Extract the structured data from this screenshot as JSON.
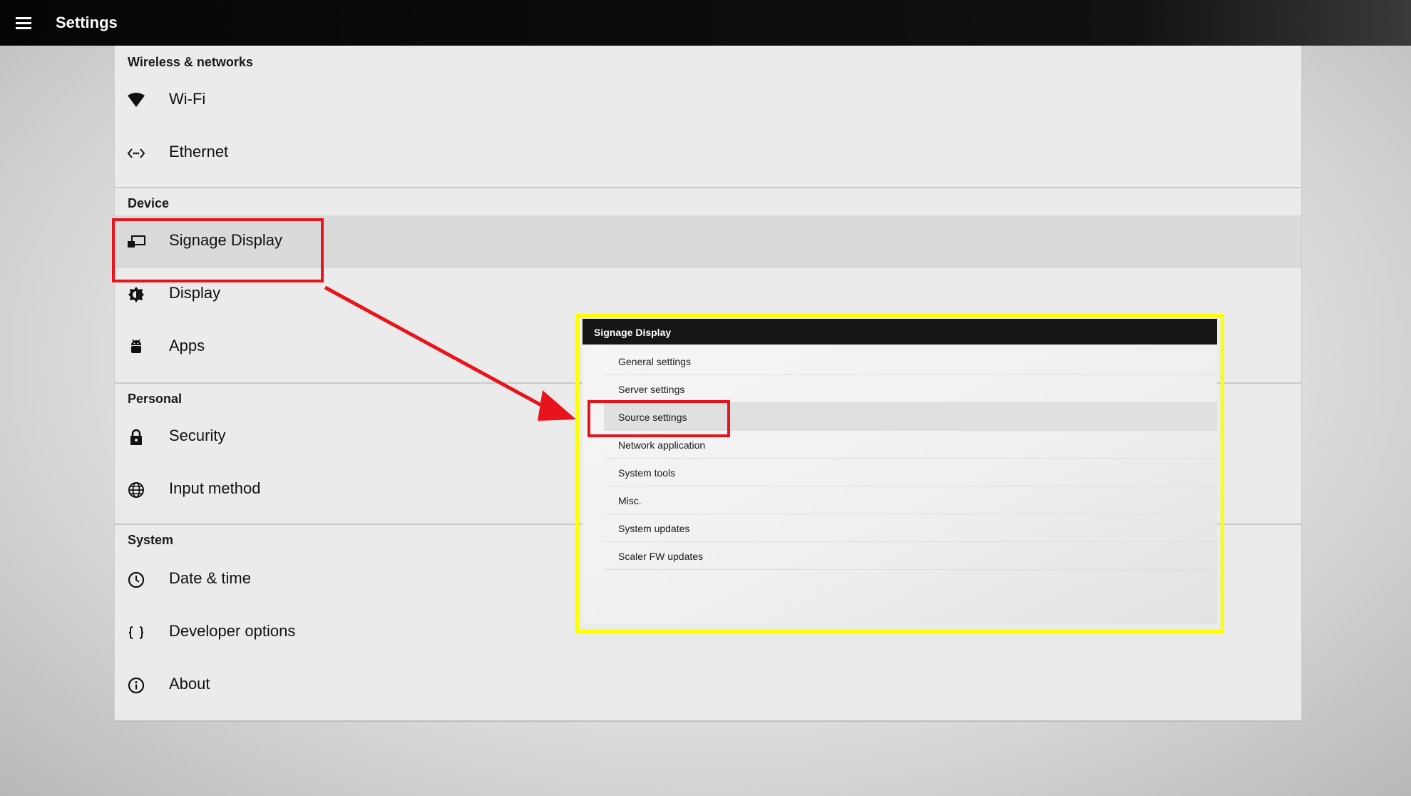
{
  "app": {
    "title": "Settings"
  },
  "sections": {
    "wireless": {
      "header": "Wireless & networks",
      "items": [
        {
          "label": "Wi-Fi",
          "icon": "wifi-icon"
        },
        {
          "label": "Ethernet",
          "icon": "ethernet-icon"
        }
      ]
    },
    "device": {
      "header": "Device",
      "items": [
        {
          "label": "Signage Display",
          "icon": "signage-display-icon"
        },
        {
          "label": "Display",
          "icon": "brightness-icon"
        },
        {
          "label": "Apps",
          "icon": "android-icon"
        }
      ]
    },
    "personal": {
      "header": "Personal",
      "items": [
        {
          "label": "Security",
          "icon": "lock-icon"
        },
        {
          "label": "Input method",
          "icon": "globe-icon"
        }
      ]
    },
    "system": {
      "header": "System",
      "items": [
        {
          "label": "Date & time",
          "icon": "clock-icon"
        },
        {
          "label": "Developer options",
          "icon": "braces-icon"
        },
        {
          "label": "About",
          "icon": "info-icon"
        }
      ]
    }
  },
  "inset": {
    "title": "Signage Display",
    "items": [
      {
        "label": "General settings"
      },
      {
        "label": "Server settings"
      },
      {
        "label": "Source settings"
      },
      {
        "label": "Network application"
      },
      {
        "label": "System tools"
      },
      {
        "label": "Misc."
      },
      {
        "label": "System updates"
      },
      {
        "label": "Scaler FW updates"
      }
    ]
  },
  "colors": {
    "highlight_red": "#e8141c",
    "highlight_yellow": "#ffff00",
    "topbar": "#050505"
  }
}
